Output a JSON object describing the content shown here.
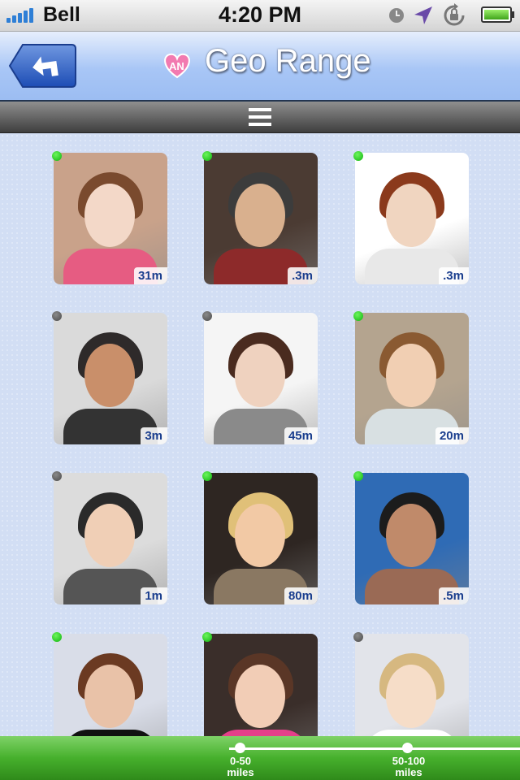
{
  "status_bar": {
    "carrier": "Bell",
    "time": "4:20 PM",
    "icons": [
      "signal-icon",
      "clock-icon",
      "location-arrow-icon",
      "rotation-lock-icon",
      "battery-icon"
    ]
  },
  "nav": {
    "title": "Geo Range",
    "back_icon": "back-arrow-icon",
    "logo_icon": "heart-logo-icon"
  },
  "toolbar": {
    "menu_icon": "hamburger-menu-icon"
  },
  "profiles": [
    {
      "distance": "31m",
      "online": true
    },
    {
      "distance": ".3m",
      "online": true
    },
    {
      "distance": ".3m",
      "online": true
    },
    {
      "distance": "3m",
      "online": false
    },
    {
      "distance": "45m",
      "online": false
    },
    {
      "distance": "20m",
      "online": true
    },
    {
      "distance": "1m",
      "online": false
    },
    {
      "distance": "80m",
      "online": true
    },
    {
      "distance": ".5m",
      "online": true
    },
    {
      "distance": "",
      "online": true
    },
    {
      "distance": "",
      "online": true
    },
    {
      "distance": "",
      "online": false
    }
  ],
  "range": {
    "options": [
      {
        "label_line1": "0-50",
        "label_line2": "miles"
      },
      {
        "label_line1": "50-100",
        "label_line2": "miles"
      }
    ]
  },
  "colors": {
    "online": "#1cc71c",
    "offline": "#555555",
    "distance_text": "#1a3e8e",
    "range_bar": "#46b02c"
  }
}
